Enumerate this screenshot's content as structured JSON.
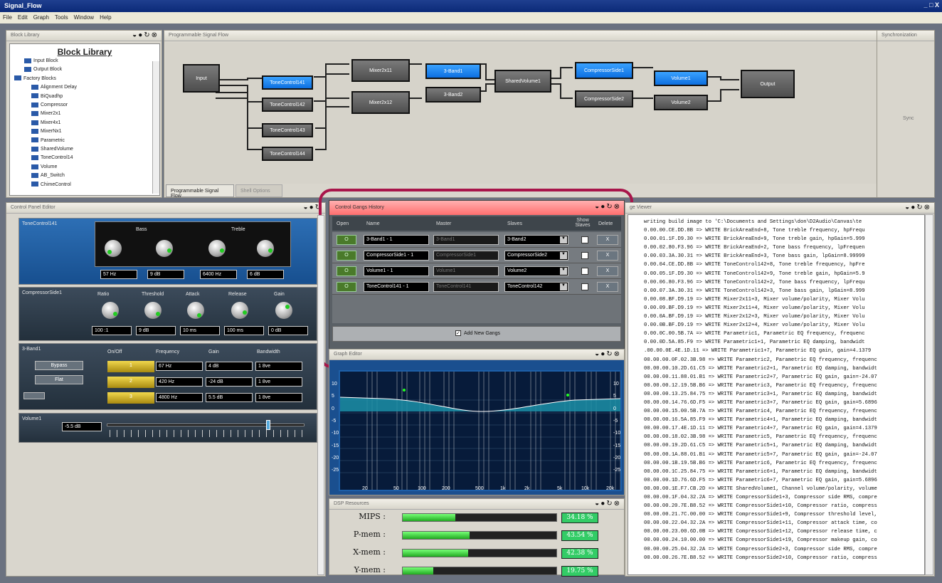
{
  "app": {
    "title": "Signal_Flow",
    "window_controls": "_ □ X"
  },
  "menu": [
    "File",
    "Edit",
    "Graph",
    "Tools",
    "Window",
    "Help"
  ],
  "block_library": {
    "header": "Block Library",
    "title": "Block Library",
    "items": [
      "Input Block",
      "Output Block",
      "Factory Blocks",
      "Alignment Delay",
      "BiQuadhp",
      "Compressor",
      "Mixer2x1",
      "Mixer4x1",
      "MixerNx1",
      "Parametric",
      "SharedVolume",
      "ToneControl14",
      "Volume",
      "AB_Switch",
      "ChimeControl"
    ]
  },
  "signal_flow": {
    "header": "Programmable Signal Flow",
    "tabs": [
      "Programmable Signal Flow",
      "Shell Options"
    ],
    "blocks": {
      "input": "Input",
      "tc141": "ToneControl141",
      "tc142": "ToneControl142",
      "tc143": "ToneControl143",
      "tc144": "ToneControl144",
      "mix11": "Mixer2x11",
      "mix12": "Mixer2x12",
      "band1": "3-Band1",
      "band2": "3-Band2",
      "shared": "SharedVolume1",
      "comp1": "CompressorSide1",
      "comp2": "CompressorSide2",
      "vol1": "Volume1",
      "vol2": "Volume2",
      "output": "Output"
    }
  },
  "sync": {
    "header": "Synchronization",
    "label": "Sync"
  },
  "control_panel": {
    "header": "Control Panel Editor",
    "tone": {
      "title": "ToneControl141",
      "bass": "Bass",
      "treble": "Treble",
      "fields": [
        "57 Hz",
        "9 dB",
        "6400 Hz",
        "6 dB"
      ]
    },
    "comp": {
      "title": "CompressorSide1",
      "labels": [
        "Ratio",
        "Threshold",
        "Attack",
        "Release",
        "Gain"
      ],
      "fields": [
        "100 :1",
        "9 dB",
        "10 ms",
        "100 ms",
        "0 dB"
      ]
    },
    "band": {
      "title": "3-Band1",
      "headers": [
        "On/Off",
        "Frequency",
        "Gain",
        "Bandwidth"
      ],
      "bypass": "Bypass",
      "flat": "Flat",
      "rows": [
        {
          "n": "1",
          "f": "67 Hz",
          "g": "4 dB",
          "b": "1 8ve"
        },
        {
          "n": "2",
          "f": "420 Hz",
          "g": "-24 dB",
          "b": "1 8ve"
        },
        {
          "n": "3",
          "f": "4800 Hz",
          "g": "5.5 dB",
          "b": "1 8ve"
        }
      ]
    },
    "volume": {
      "title": "Volume1",
      "value": "-5.5 dB"
    }
  },
  "gangs": {
    "header": "Control Gangs History",
    "columns": [
      "Open",
      "Name",
      "Master",
      "Slaves",
      "Show Slaves",
      "Delete"
    ],
    "open_label": "O",
    "delete_label": "X",
    "rows": [
      {
        "name": "3-Band1 - 1",
        "master": "3-Band1",
        "slave": "3-Band2"
      },
      {
        "name": "CompressorSide1 - 1",
        "master": "CompressorSide1",
        "slave": "CompressorSide2"
      },
      {
        "name": "Volume1 - 1",
        "master": "Volume1",
        "slave": "Volume2"
      },
      {
        "name": "ToneControl141 - 1",
        "master": "ToneControl141",
        "slave": "ToneControl142"
      }
    ],
    "add_label": "Add New Gangs"
  },
  "graph": {
    "header": "Graph Editor",
    "y_ticks": [
      "10",
      "5",
      "0",
      "-5",
      "-10",
      "-15",
      "-20",
      "-25"
    ],
    "x_ticks": [
      "20",
      "50",
      "100",
      "200",
      "500",
      "1k",
      "2k",
      "5k",
      "10k",
      "20k"
    ]
  },
  "dsp": {
    "header": "DSP Resources",
    "items": [
      {
        "label": "MIPS :",
        "value": "34.18 %",
        "pct": 34.18
      },
      {
        "label": "P-mem :",
        "value": "43.54 %",
        "pct": 43.54
      },
      {
        "label": "X-mem :",
        "value": "42.38 %",
        "pct": 42.38
      },
      {
        "label": "Y-mem :",
        "value": "19.75 %",
        "pct": 19.75
      }
    ]
  },
  "message": {
    "header": "ge Viewer",
    "lines": [
      "writing build image to 'C:\\Documents and Settings\\don\\D2Audio\\Canvas\\te",
      "0.00.00.CE.DD.8B => WRITE BrickAreaEnd+8, Tone treble frequency, hpFrequ",
      "0.00.01.1F.D9.30 => WRITE BrickAreaEnd+9, Tone treble gain, hpGain=5.999",
      "0.00.02.80.F3.96 => WRITE BrickAreaEnd+2, Tone bass frequency, lpFrequen",
      "0.00.03.3A.30.31 => WRITE BrickAreaEnd+3, Tone bass gain, lpGain=8.99999",
      "0.00.04.CE.DD.8B => WRITE ToneControl142+8, Tone treble frequency, hpFre",
      "0.00.05.1F.D9.30 => WRITE ToneControl142+9, Tone treble gain, hpGain=5.9",
      "0.00.06.80.F3.96 => WRITE ToneControl142+2, Tone bass frequency, lpFrequ",
      "0.00.07.3A.30.31 => WRITE ToneControl142+3, Tone bass gain, lpGain=8.999",
      "0.00.08.BF.D9.19 => WRITE Mixer2x11+3, Mixer volume/polarity, Mixer Volu",
      "0.00.09.BF.D9.19 => WRITE Mixer2x11+4, Mixer volume/polarity, Mixer Volu",
      "0.00.0A.BF.D9.19 => WRITE Mixer2x12+3, Mixer volume/polarity, Mixer Volu",
      "0.00.0B.BF.D9.19 => WRITE Mixer2x12+4, Mixer volume/polarity, Mixer Volu",
      "0.00.0C.00.5B.7A => WRITE Parametric1, Parametric EQ frequency, frequenc",
      "0.00.0D.5A.85.F9 => WRITE Parametric1+1, Parametric EQ damping, bandwidt",
      ".00.00.0E.4E.1D.11 => WRITE Parametric1+7, Parametric EQ gain, gain=4.1379",
      "00.00.00.0F.02.3B.98 => WRITE Parametric2, Parametric EQ frequency, frequenc",
      "00.00.00.10.2D.61.C5 => WRITE Parametric2+1, Parametric EQ damping, bandwidt",
      "00.00.00.11.88.01.B1 => WRITE Parametric2+7, Parametric EQ gain, gain=-24.07",
      "00.00.00.12.19.5B.B6 => WRITE Parametric3, Parametric EQ frequency, frequenc",
      "00.00.00.13.25.84.75 => WRITE Parametric3+1, Parametric EQ damping, bandwidt",
      "00.00.00.14.76.6D.F5 => WRITE Parametric3+7, Parametric EQ gain, gain=5.6896",
      "00.00.00.15.00.5B.7A => WRITE Parametric4, Parametric EQ frequency, frequenc",
      "00.00.00.16.5A.85.F9 => WRITE Parametric4+1, Parametric EQ damping, bandwidt",
      "00.00.00.17.4E.1D.11 => WRITE Parametric4+7, Parametric EQ gain, gain=4.1379",
      "00.00.00.18.02.3B.98 => WRITE Parametric5, Parametric EQ frequency, frequenc",
      "00.00.00.19.2D.61.C5 => WRITE Parametric5+1, Parametric EQ damping, bandwidt",
      "00.00.00.1A.88.01.B1 => WRITE Parametric5+7, Parametric EQ gain, gain=-24.07",
      "00.00.00.1B.19.5B.B6 => WRITE Parametric6, Parametric EQ frequency, frequenc",
      "00.00.00.1C.25.84.75 => WRITE Parametric6+1, Parametric EQ damping, bandwidt",
      "00.00.00.1D.76.6D.F5 => WRITE Parametric6+7, Parametric EQ gain, gain=5.6896",
      "00.00.00.1E.F7.CB.2D => WRITE SharedVolume1, Channel volume/polarity, volume",
      "00.00.00.1F.04.32.2A => WRITE CompressorSide1+3, Compressor side RMS, compre",
      "00.00.00.20.7E.B8.52 => WRITE CompressorSide1+10, Compressor ratio, compress",
      "00.00.00.21.7C.00.00 => WRITE CompressorSide1+9, Compressor threshold level,",
      "00.00.00.22.04.32.2A => WRITE CompressorSide1+11, Compressor attack time, co",
      "00.00.00.23.00.6D.0B => WRITE CompressorSide1+12, Compressor release time, c",
      "00.00.00.24.10.00.00 => WRITE CompressorSide1+19, Compressor makeup gain, co",
      "00.00.00.25.04.32.2A => WRITE CompressorSide2+3, Compressor side RMS, compre",
      "00.00.00.26.7E.B8.52 => WRITE CompressorSide2+10, Compressor ratio, compress"
    ]
  }
}
